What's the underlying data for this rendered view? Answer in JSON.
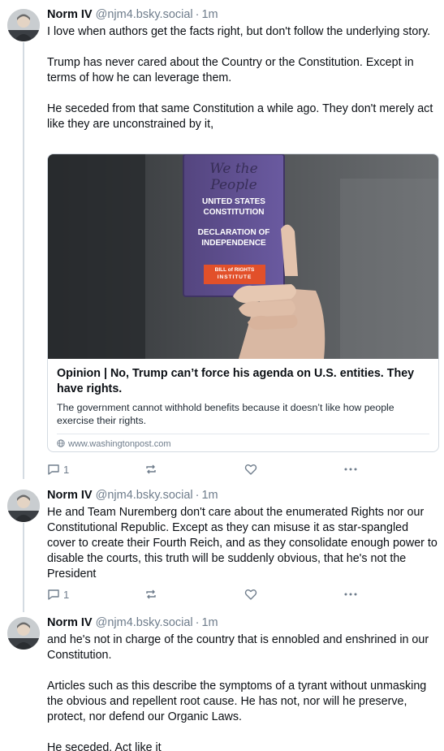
{
  "posts": [
    {
      "author": "Norm IV",
      "handle": "@njm4.bsky.social",
      "separator": "·",
      "time": "1m",
      "text": "I love when authors get the facts right, but don't follow the underlying story.\n\nTrump has never cared about the Country or the Constitution.  Except in terms of how he can leverage them.\n\nHe seceded from that same Constitution a while ago. They don't merely act like they are unconstrained by it,",
      "reply_count": "1",
      "embed": {
        "book_lines": [
          "We the People",
          "UNITED STATES",
          "CONSTITUTION",
          "DECLARATION OF",
          "INDEPENDENCE",
          "BILL of RIGHTS",
          "INSTITUTE"
        ],
        "title": "Opinion | No, Trump can’t force his agenda on U.S. entities. They have rights.",
        "description": "The government cannot withhold benefits because it doesn’t like how people exercise their rights.",
        "domain": "www.washingtonpost.com"
      }
    },
    {
      "author": "Norm IV",
      "handle": "@njm4.bsky.social",
      "separator": "·",
      "time": "1m",
      "text": "He and Team Nuremberg don't care about the enumerated Rights nor our Constitutional Republic. Except as they can misuse it as star-spangled cover to create their Fourth Reich, and as they consolidate enough power to disable the courts, this truth will be suddenly obvious, that he's not the President",
      "reply_count": "1"
    },
    {
      "author": "Norm IV",
      "handle": "@njm4.bsky.social",
      "separator": "·",
      "time": "1m",
      "text": "and he's not in charge of the country that is ennobled and enshrined in our Constitution.\n\nArticles such as this describe the symptoms of a tyrant without unmasking the obvious and repellent root cause. He has not, nor will he preserve, protect, nor defend our Organic Laws.\n\nHe seceded.  Act like it"
    }
  ],
  "icons": {
    "reply": "reply-icon",
    "repost": "repost-icon",
    "like": "heart-icon",
    "more": "more-icon",
    "globe": "globe-icon"
  },
  "colors": {
    "text": "#0b0f14",
    "muted": "#6f7d8c",
    "border": "#d4dbe2",
    "book": "#5d4f8c",
    "book_badge": "#e2502a"
  }
}
